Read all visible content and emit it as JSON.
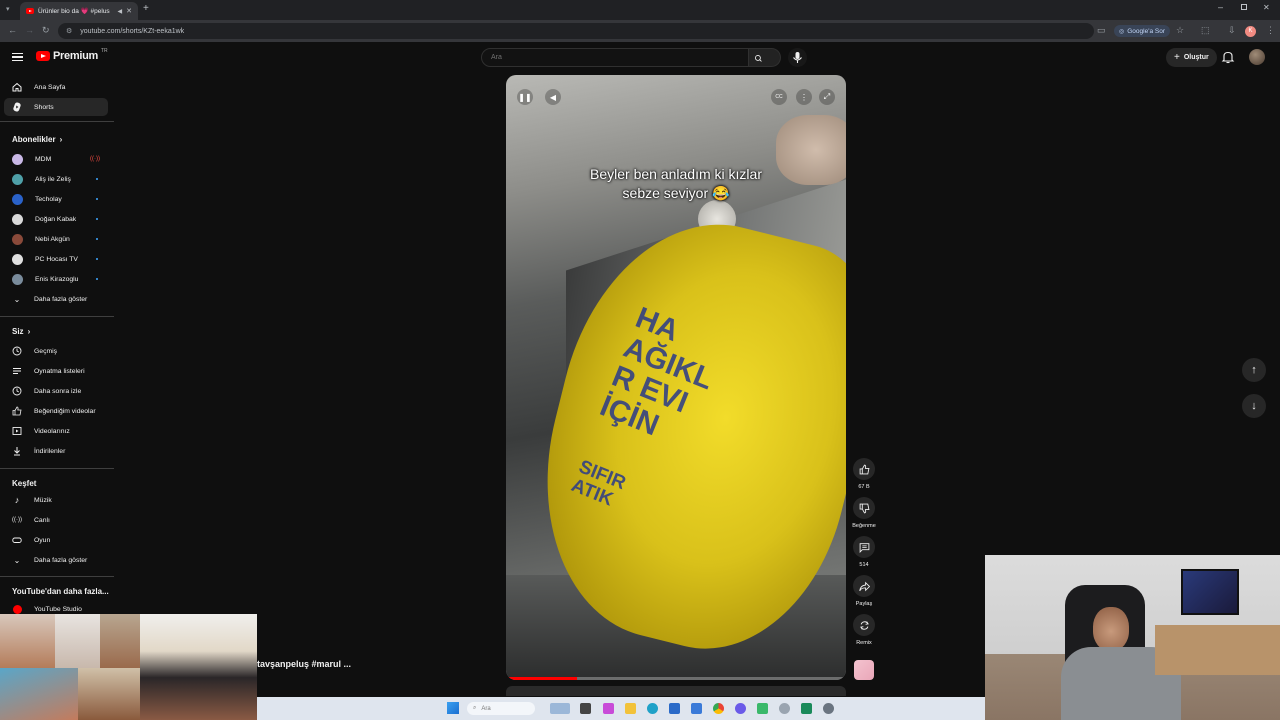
{
  "browser": {
    "tab_title": "Ürünler bio da 💗 #pelus",
    "url": "youtube.com/shorts/KZt-eeka1wk",
    "google_sor": "Google'a Sor",
    "profile_initial": "K"
  },
  "header": {
    "logo_text": "Premium",
    "logo_region": "TR",
    "search_placeholder": "Ara",
    "create_label": "Oluştur"
  },
  "sidebar": {
    "main": [
      {
        "label": "Ana Sayfa",
        "icon": "home-icon"
      },
      {
        "label": "Shorts",
        "icon": "shorts-icon",
        "active": true
      }
    ],
    "subscriptions_title": "Abonelikler",
    "channels": [
      {
        "label": "MDM",
        "color": "#c9b8e6",
        "live": true
      },
      {
        "label": "Aliş ile Zeliş",
        "color": "#4fa0a8"
      },
      {
        "label": "Techolay",
        "color": "#2a62c9"
      },
      {
        "label": "Doğan Kabak",
        "color": "#d9d9d9"
      },
      {
        "label": "Nebi Akgün",
        "color": "#8a4a3a"
      },
      {
        "label": "PC Hocası TV",
        "color": "#e0e0e0"
      },
      {
        "label": "Enis Kirazoglu",
        "color": "#7a8c9c"
      }
    ],
    "show_more": "Daha fazla göster",
    "you_title": "Siz",
    "you_items": [
      {
        "label": "Geçmiş",
        "icon": "history-icon"
      },
      {
        "label": "Oynatma listeleri",
        "icon": "playlist-icon"
      },
      {
        "label": "Daha sonra izle",
        "icon": "watch-later-icon"
      },
      {
        "label": "Beğendiğim videolar",
        "icon": "liked-icon"
      },
      {
        "label": "Videolarınız",
        "icon": "your-videos-icon"
      },
      {
        "label": "İndirilenler",
        "icon": "download-icon"
      }
    ],
    "explore_title": "Keşfet",
    "explore_items": [
      {
        "label": "Müzik",
        "icon": "music-icon"
      },
      {
        "label": "Canlı",
        "icon": "live-icon"
      },
      {
        "label": "Oyun",
        "icon": "gaming-icon"
      }
    ],
    "explore_show_more": "Daha fazla göster",
    "more_title": "YouTube'dan daha fazla...",
    "more_items": [
      {
        "label": "YouTube Studio"
      }
    ]
  },
  "video": {
    "caption_line1": "Beyler ben anladım ki kızlar",
    "caption_line2": "sebze seviyor 😂",
    "bag_text": "HA\nAĞIKL\nR EVI\nİÇİN",
    "bag_text2": "SIFIR\nATIK",
    "progress": 0.21
  },
  "actions": {
    "like_count": "67 B",
    "dislike_label": "Beğenme",
    "comment_count": "514",
    "share_label": "Paylaş",
    "remix_label": "Remix"
  },
  "bottom_title": "tavşanpeluş #marul ...",
  "taskbar": {
    "search_placeholder": "Ara"
  }
}
